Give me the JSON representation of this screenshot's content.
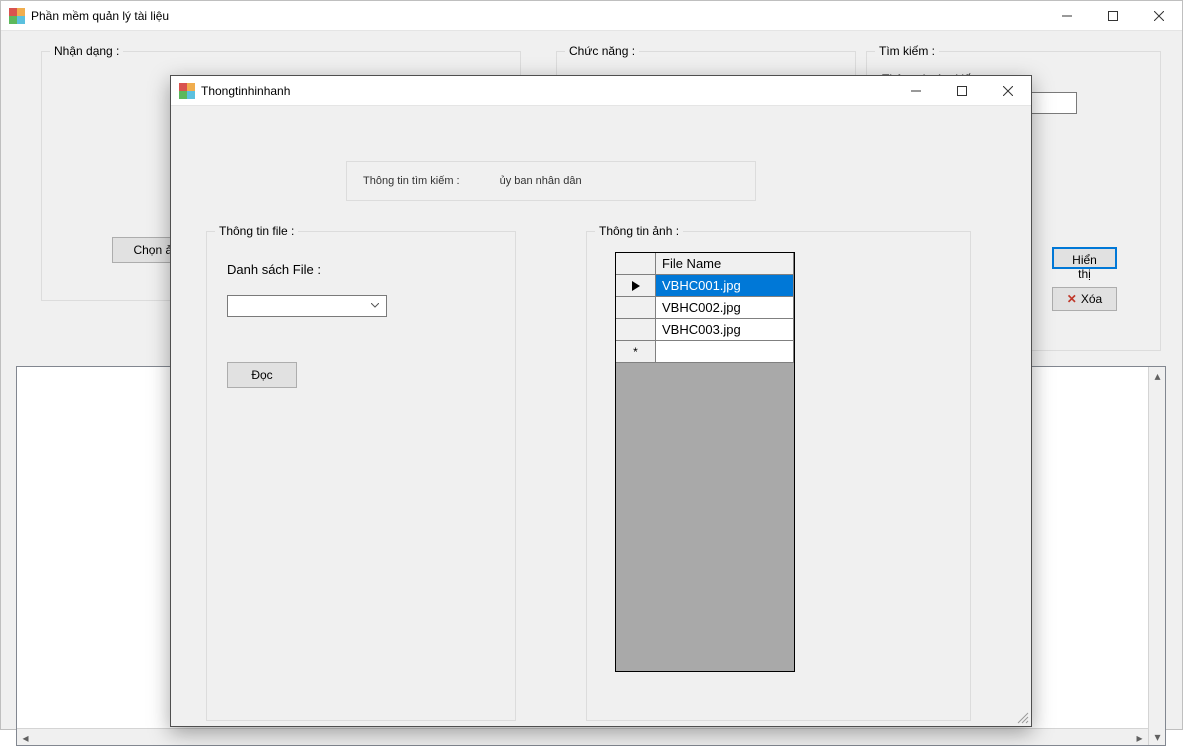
{
  "main": {
    "title": "Phần mềm quản lý tài liệu",
    "nhandang": {
      "legend": "Nhận dạng :",
      "chon_anh": "Chọn ảnh"
    },
    "chucnang": {
      "legend": "Chức năng :"
    },
    "timkiem": {
      "legend": "Tìm kiếm :",
      "info_label": "Thông tin tìm kiếm :",
      "search_value": "",
      "hien_thi": "Hiển thị",
      "xoa": "Xóa"
    }
  },
  "dialog": {
    "title": "Thongtinhinhanh",
    "search_label": "Thông tin tìm kiếm :",
    "search_value": "ủy ban nhân dân",
    "fileinfo": {
      "legend": "Thông tin file :",
      "ds_label": "Danh sách File :",
      "doc": "Đọc"
    },
    "imginfo": {
      "legend": "Thông tin ảnh :",
      "header": "File Name",
      "rows": [
        "VBHC001.jpg",
        "VBHC002.jpg",
        "VBHC003.jpg"
      ]
    }
  }
}
